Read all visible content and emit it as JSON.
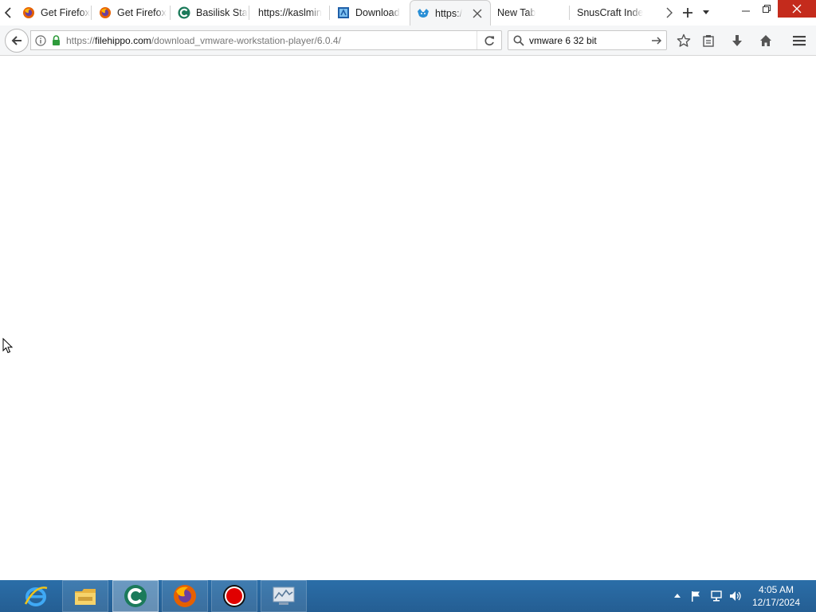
{
  "browser": {
    "tabs": [
      {
        "label": "Get Firefox",
        "icon": "firefox-icon"
      },
      {
        "label": "Get Firefox",
        "icon": "firefox-icon"
      },
      {
        "label": "Basilisk Sta",
        "icon": "basilisk-icon"
      },
      {
        "label": "https://kaslmin",
        "icon": "none"
      },
      {
        "label": "Download",
        "icon": "download-site-icon"
      },
      {
        "label": "https:/",
        "icon": "filehippo-icon",
        "active": true
      },
      {
        "label": "New Tab",
        "icon": "none"
      },
      {
        "label": "SnusCraft Inde",
        "icon": "none"
      }
    ],
    "url": {
      "scheme": "https://",
      "host": "filehippo.com",
      "path": "/download_vmware-workstation-player/6.0.4/"
    },
    "search": {
      "query": "vmware 6 32 bit"
    }
  },
  "taskbar": {
    "apps": [
      {
        "name": "internet-explorer"
      },
      {
        "name": "file-explorer"
      },
      {
        "name": "basilisk",
        "active": true
      },
      {
        "name": "firefox"
      },
      {
        "name": "screen-recorder"
      },
      {
        "name": "system-app"
      }
    ],
    "clock": {
      "time": "4:05 AM",
      "date": "12/17/2024"
    }
  },
  "colors": {
    "taskbar": "#2b6ea8",
    "window_close": "#c42b1c",
    "lock_green": "#2e9b3b"
  }
}
